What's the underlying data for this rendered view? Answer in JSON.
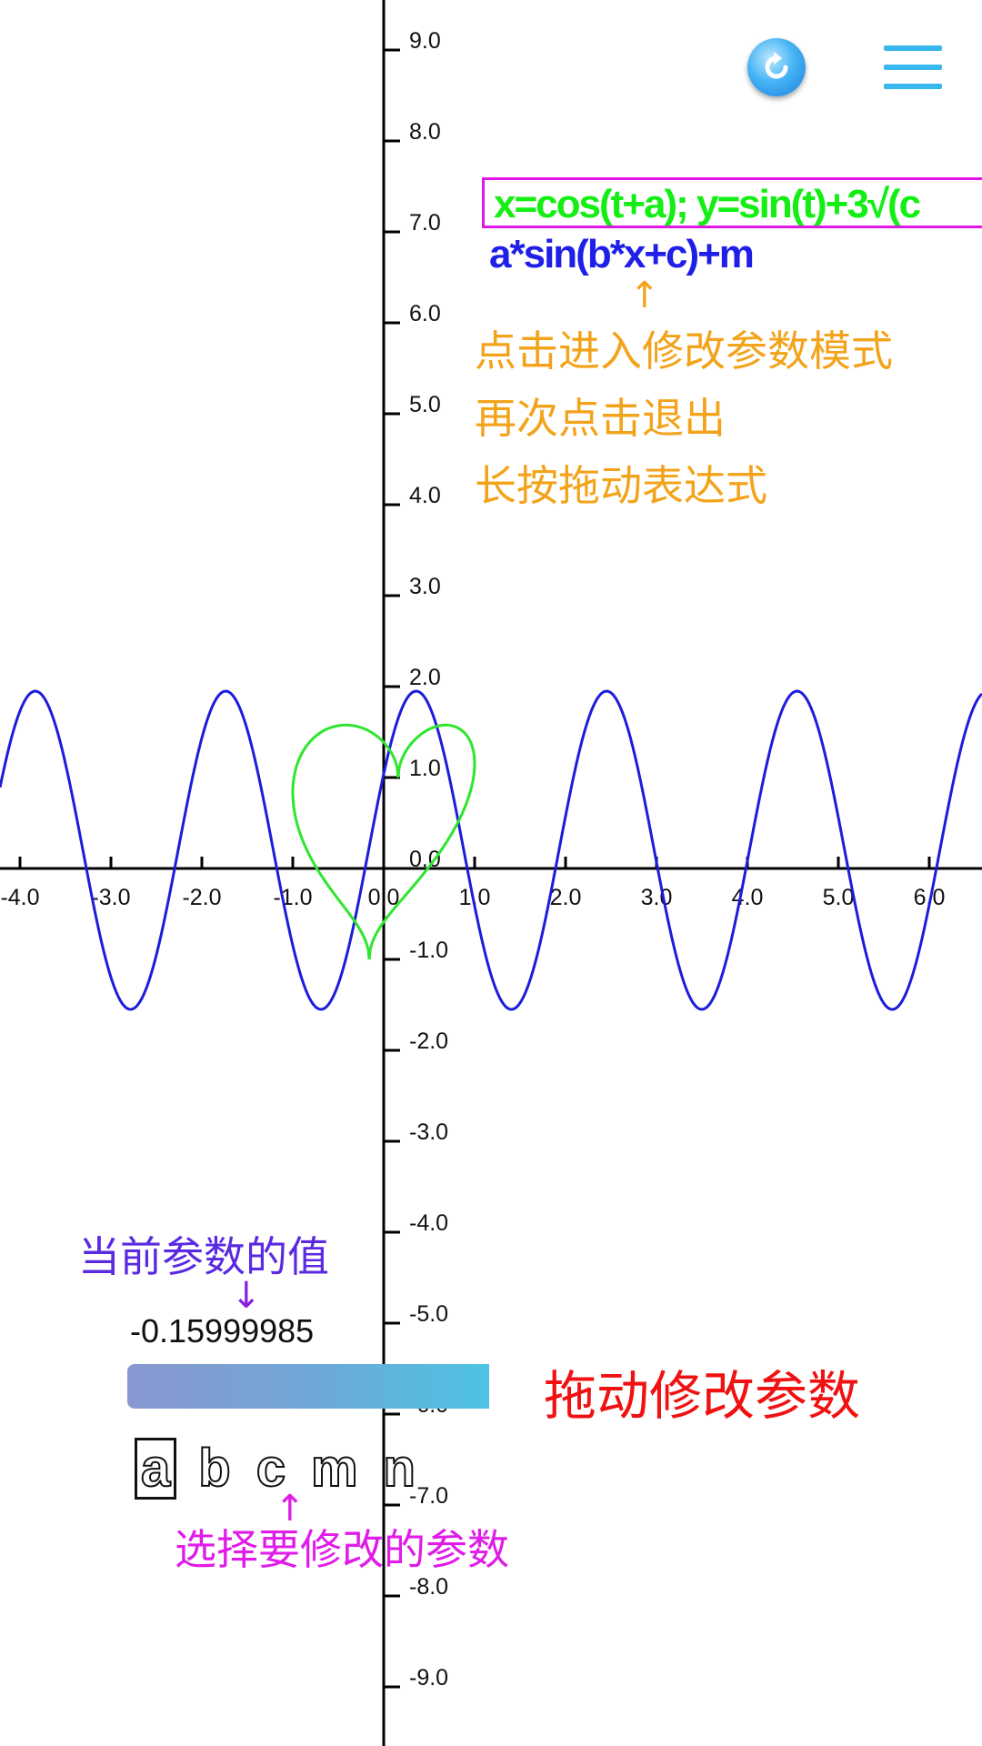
{
  "chart_data": {
    "type": "line",
    "x_ticks": [
      "-4.0",
      "-3.0",
      "-2.0",
      "-1.0",
      "0.0",
      "1.0",
      "2.0",
      "3.0",
      "4.0",
      "5.0",
      "6.0"
    ],
    "y_ticks": [
      "9.0",
      "8.0",
      "7.0",
      "6.0",
      "5.0",
      "4.0",
      "3.0",
      "2.0",
      "1.0",
      "0.0",
      "-1.0",
      "-2.0",
      "-3.0",
      "-4.0",
      "-5.0",
      "-6.0",
      "-7.0",
      "-8.0",
      "-9.0"
    ],
    "x_range": [
      -4.2,
      6.6
    ],
    "y_range": [
      -9.5,
      9.5
    ],
    "grid": false,
    "series": [
      {
        "type": "function",
        "color": "#1c1cdc",
        "a": 1.75,
        "b": 3.0,
        "c": 0.5,
        "m": 0.2
      },
      {
        "type": "parametric",
        "color": "#2ee62e",
        "a": -0.15999985
      }
    ]
  },
  "expressions": {
    "parametric": "x=cos(t+a); y=sin(t)+3√(c",
    "function": "a*sin(b*x+c)+m"
  },
  "hints": {
    "arrow_up": "↑",
    "arrow_down": "↓",
    "tap_enter": "点击进入修改参数模式",
    "tap_exit": "再次点击退出",
    "long_press": "长按拖动表达式",
    "current_value_title": "当前参数的值",
    "drag_label": "拖动修改参数",
    "select_label": "选择要修改的参数"
  },
  "current_value": "-0.15999985",
  "slider": {
    "fraction": 0.5
  },
  "params": [
    "a",
    "b",
    "c",
    "m",
    "n"
  ],
  "selected_param": "a",
  "icons": {
    "refresh": "refresh-icon",
    "menu": "hamburger-menu-icon"
  }
}
